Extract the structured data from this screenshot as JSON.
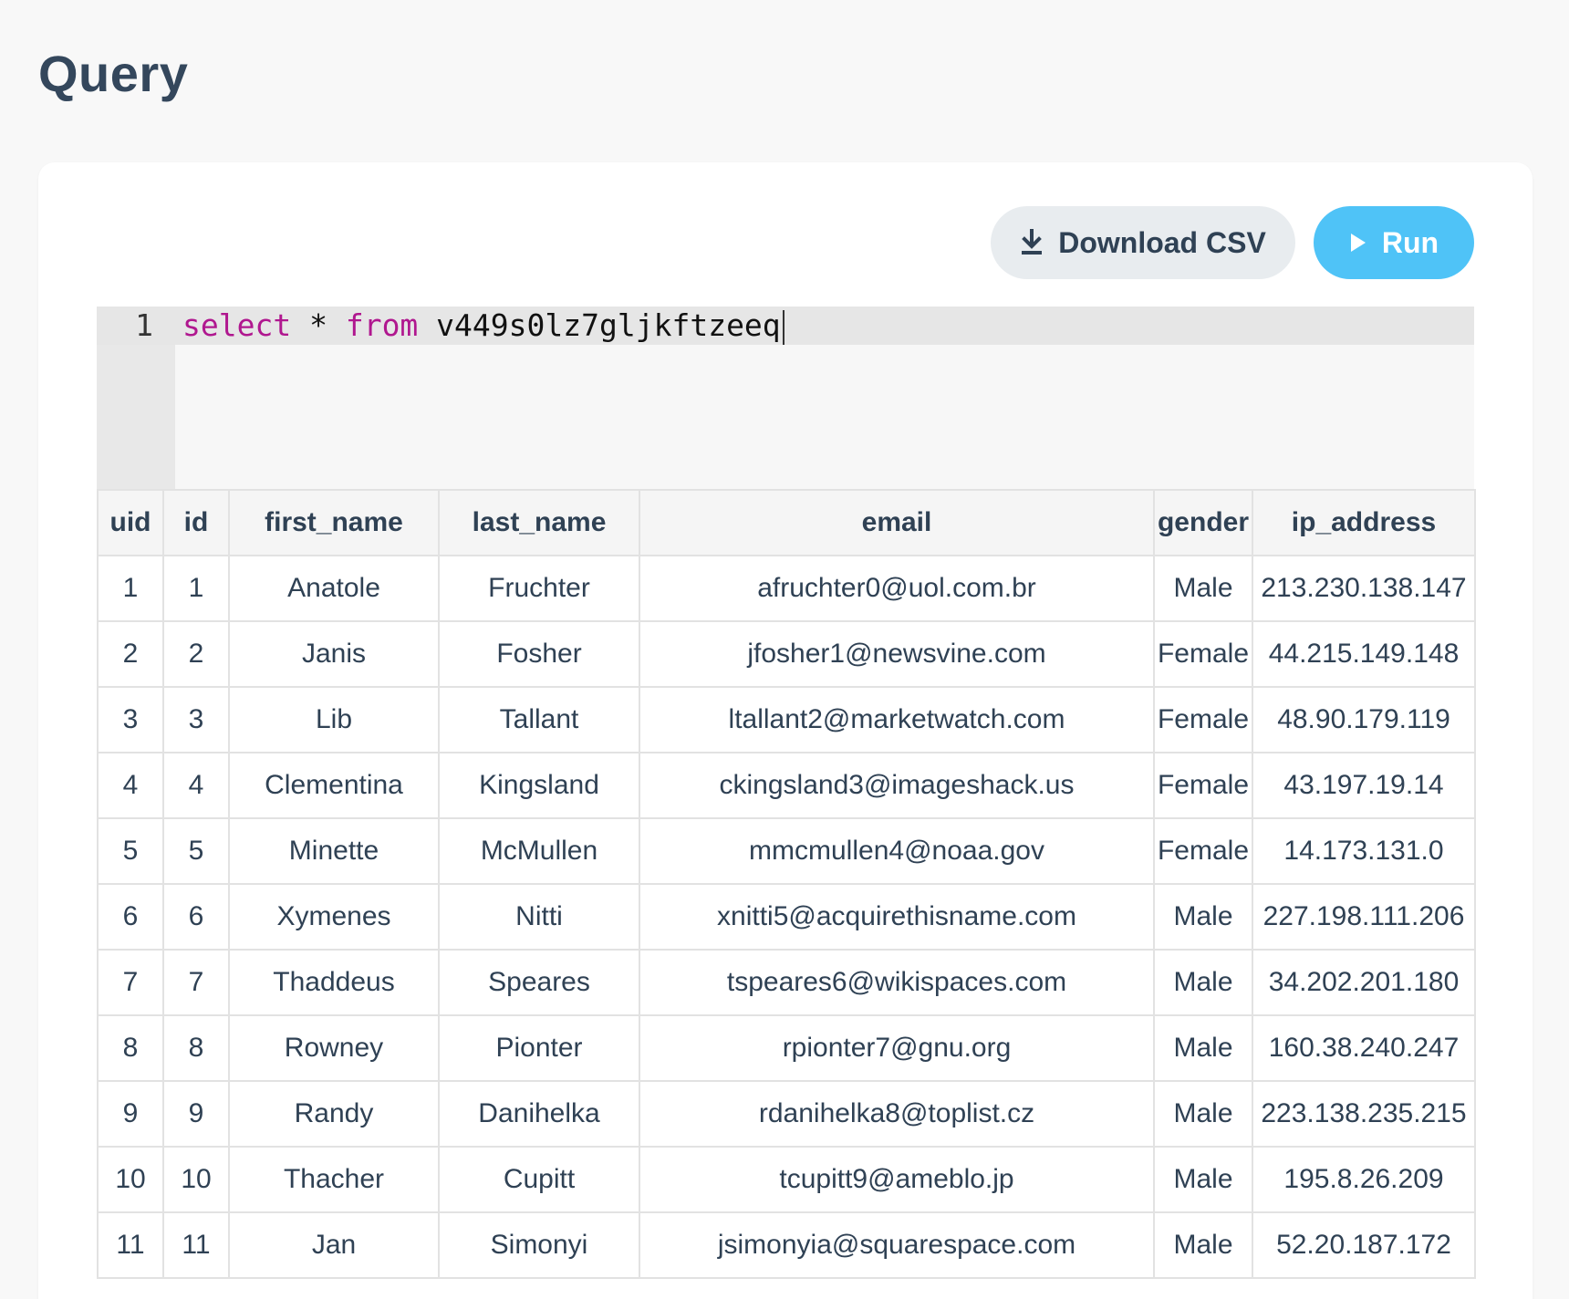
{
  "page": {
    "title": "Query"
  },
  "toolbar": {
    "download_label": "Download CSV",
    "run_label": "Run"
  },
  "editor": {
    "line_number": "1",
    "keyword_select": "select",
    "star": " * ",
    "keyword_from": "from",
    "table_name": " v449s0lz7gljkftzeeq"
  },
  "results": {
    "columns": [
      "uid",
      "id",
      "first_name",
      "last_name",
      "email",
      "gender",
      "ip_address"
    ],
    "rows": [
      [
        "1",
        "1",
        "Anatole",
        "Fruchter",
        "afruchter0@uol.com.br",
        "Male",
        "213.230.138.147"
      ],
      [
        "2",
        "2",
        "Janis",
        "Fosher",
        "jfosher1@newsvine.com",
        "Female",
        "44.215.149.148"
      ],
      [
        "3",
        "3",
        "Lib",
        "Tallant",
        "ltallant2@marketwatch.com",
        "Female",
        "48.90.179.119"
      ],
      [
        "4",
        "4",
        "Clementina",
        "Kingsland",
        "ckingsland3@imageshack.us",
        "Female",
        "43.197.19.14"
      ],
      [
        "5",
        "5",
        "Minette",
        "McMullen",
        "mmcmullen4@noaa.gov",
        "Female",
        "14.173.131.0"
      ],
      [
        "6",
        "6",
        "Xymenes",
        "Nitti",
        "xnitti5@acquirethisname.com",
        "Male",
        "227.198.111.206"
      ],
      [
        "7",
        "7",
        "Thaddeus",
        "Speares",
        "tspeares6@wikispaces.com",
        "Male",
        "34.202.201.180"
      ],
      [
        "8",
        "8",
        "Rowney",
        "Pionter",
        "rpionter7@gnu.org",
        "Male",
        "160.38.240.247"
      ],
      [
        "9",
        "9",
        "Randy",
        "Danihelka",
        "rdanihelka8@toplist.cz",
        "Male",
        "223.138.235.215"
      ],
      [
        "10",
        "10",
        "Thacher",
        "Cupitt",
        "tcupitt9@ameblo.jp",
        "Male",
        "195.8.26.209"
      ],
      [
        "11",
        "11",
        "Jan",
        "Simonyi",
        "jsimonyia@squarespace.com",
        "Male",
        "52.20.187.172"
      ]
    ]
  },
  "colors": {
    "accent": "#4fc3f7",
    "keyword": "#b0178f",
    "text": "#2f4154"
  }
}
